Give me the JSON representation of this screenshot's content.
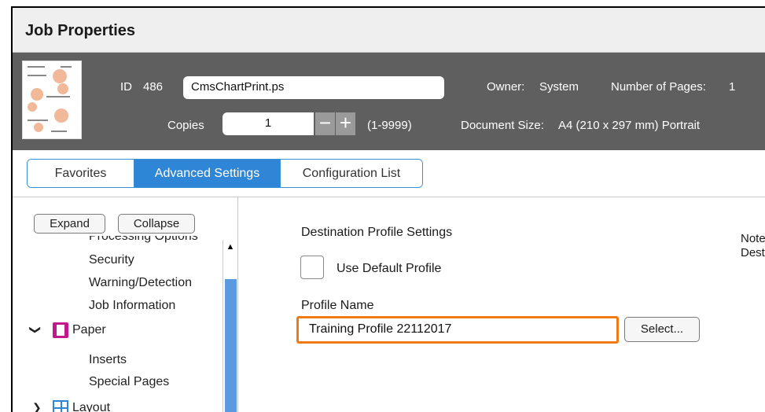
{
  "window": {
    "title": "Job Properties"
  },
  "job": {
    "id_label": "ID",
    "id_value": "486",
    "filename": "CmsChartPrint.ps",
    "owner_label": "Owner:",
    "owner_value": "System",
    "pages_label": "Number of Pages:",
    "pages_value": "1",
    "copies_label": "Copies",
    "copies_value": "1",
    "minus_glyph": "−",
    "plus_glyph": "+",
    "copies_range": "(1-9999)",
    "docsize_label": "Document Size:",
    "docsize_value": "A4 (210 x 297 mm) Portrait"
  },
  "tabs": [
    {
      "label": "Favorites",
      "active": false
    },
    {
      "label": "Advanced Settings",
      "active": true
    },
    {
      "label": "Configuration List",
      "active": false
    }
  ],
  "tree": {
    "expand_label": "Expand",
    "collapse_label": "Collapse",
    "items": {
      "processing_options": "Processing Options",
      "security": "Security",
      "warning_detection": "Warning/Detection",
      "job_information": "Job Information",
      "paper": "Paper",
      "inserts": "Inserts",
      "special_pages": "Special Pages",
      "layout": "Layout"
    },
    "chevron_down": "❯",
    "chevron_right": "❯",
    "scroll_up_glyph": "▲"
  },
  "destination": {
    "heading": "Destination Profile Settings",
    "use_default_label": "Use Default Profile",
    "profile_name_label": "Profile Name",
    "profile_name_value": "Training Profile 22112017",
    "select_label": "Select...",
    "note_label": "Note:",
    "note_text": "Destin"
  },
  "colors": {
    "accent": "#2f86d6",
    "header_bg": "#5f5f5f",
    "highlight": "#f07a14",
    "paper_icon": "#c2188c"
  }
}
